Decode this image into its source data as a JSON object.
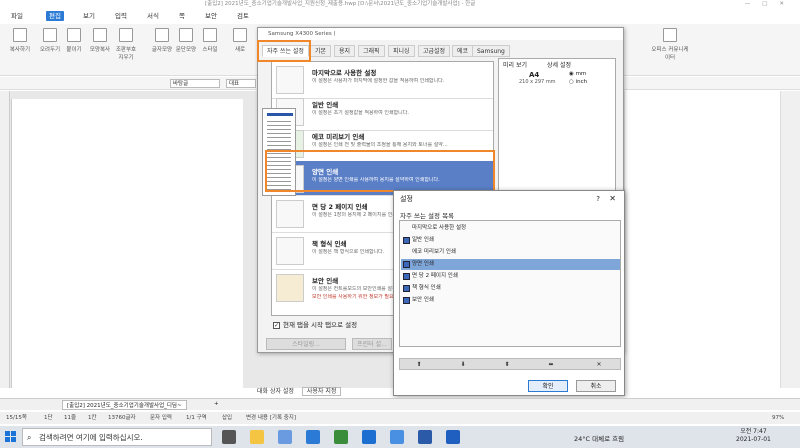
{
  "window": {
    "title": "[출입2] 2021년도_중소기업기술개발사업_지원신청_제출용.hwp [D:\\문서\\2021년도_중소기업기술개발사업] - 한글",
    "controls": [
      "—",
      "□",
      "✕"
    ]
  },
  "menubar": {
    "items": [
      {
        "label": "파일"
      },
      {
        "label": "편집",
        "active": true
      },
      {
        "label": "보기"
      },
      {
        "label": "입력"
      },
      {
        "label": "서식"
      },
      {
        "label": "쪽"
      },
      {
        "label": "보안"
      },
      {
        "label": "검토"
      }
    ]
  },
  "ribbon": {
    "buttons": [
      "복사하기",
      "오려두기",
      "붙이기",
      "모양복사",
      "조판부호지우기",
      "글자모양",
      "문단모양",
      "스타일",
      "새로"
    ],
    "right_button": "오피스 커뮤니케이터"
  },
  "toolbar2": {
    "style": "바탕글",
    "style2": "대표"
  },
  "print_dialog": {
    "title": "Samsung X4300 Series (",
    "tabs": [
      "자주 쓰는 설정",
      "기본",
      "용지",
      "그래픽",
      "피니싱",
      "고급설정",
      "에코",
      "Samsung"
    ],
    "presets": [
      {
        "name": "마지막으로 사용한 설정",
        "desc": "이 설정은 사용자가 마지막에 설정한 값을 적용하여 인쇄합니다."
      },
      {
        "name": "일반 인쇄",
        "desc": "이 설정은 초기 설정값을 적용하여 인쇄합니다."
      },
      {
        "name": "에코 미리보기 인쇄",
        "desc": "이 설정은 인쇄 전 및 출력물의 조정을 통해 용지와 토너를 절약..."
      },
      {
        "name": "양면 인쇄",
        "desc": "이 설정은 양면 인쇄를 사용하여 용지를 절약하여 인쇄합니다.",
        "selected": true
      },
      {
        "name": "면 당 2 페이지 인쇄",
        "desc": "이 설정은 1장의 용지에 2 페이지를 인쇄합니다."
      },
      {
        "name": "책 형식 인쇄",
        "desc": "이 설정은 책 형식으로 인쇄합니다."
      },
      {
        "name": "보안 인쇄",
        "desc": "이 설정은 컨트롤모드의 보안인쇄를 설정합니다.",
        "warning": "보안 인쇄를 사용하기 위한 정보가 필요합니다."
      }
    ],
    "checkbox_label": "현재 탭을 시작 탭으로 설정",
    "buttons": [
      "스타일링...",
      "프린터 설..."
    ],
    "preview_tab": "미리 보기",
    "detail_tab": "상세 설정",
    "paper_size": "A4",
    "paper_dims": "210 x 297 mm",
    "unit_mm": "mm",
    "unit_inch": "inch",
    "footer": "대화 상자 설정",
    "footer_value": "사용자 지정"
  },
  "settings_dialog": {
    "title": "설정",
    "help": "?",
    "close": "✕",
    "list_label": "자주 쓰는 설정 목록",
    "items": [
      {
        "label": "마지막으로 사용한 설정",
        "icon": false
      },
      {
        "label": "일반 인쇄",
        "icon": true
      },
      {
        "label": "에코 미리보기 인쇄",
        "icon": false
      },
      {
        "label": "양면 인쇄",
        "icon": true,
        "selected": true
      },
      {
        "label": "면 당 2 페이지 인쇄",
        "icon": true
      },
      {
        "label": "책 형식 인쇄",
        "icon": true
      },
      {
        "label": "보안 인쇄",
        "icon": true
      }
    ],
    "tools": [
      "⬆",
      "⬇",
      "⬍",
      "⬌",
      "✕"
    ],
    "ok": "확인",
    "cancel": "취소"
  },
  "doc_tabs": {
    "active": "[출입2] 2021년도_중소기업기술개발사업_디딤~",
    "add": "+"
  },
  "statusbar": {
    "items": [
      "15/15쪽",
      "1단",
      "11줄",
      "1칸",
      "13760글자",
      "문자 입력",
      "1/1 구역",
      "삽입",
      "변경 내용 [기록 중지]"
    ],
    "zoom": "97%"
  },
  "taskbar": {
    "search_placeholder": "검색하려면 여기에 입력하십시오.",
    "weather": "24°C 대체로 흐림",
    "time": "오전 7:47",
    "date": "2021-07-01"
  },
  "colors": {
    "accent": "#2b7bd6",
    "highlight": "#f0882b",
    "selected_row": "#5b7fc6"
  }
}
